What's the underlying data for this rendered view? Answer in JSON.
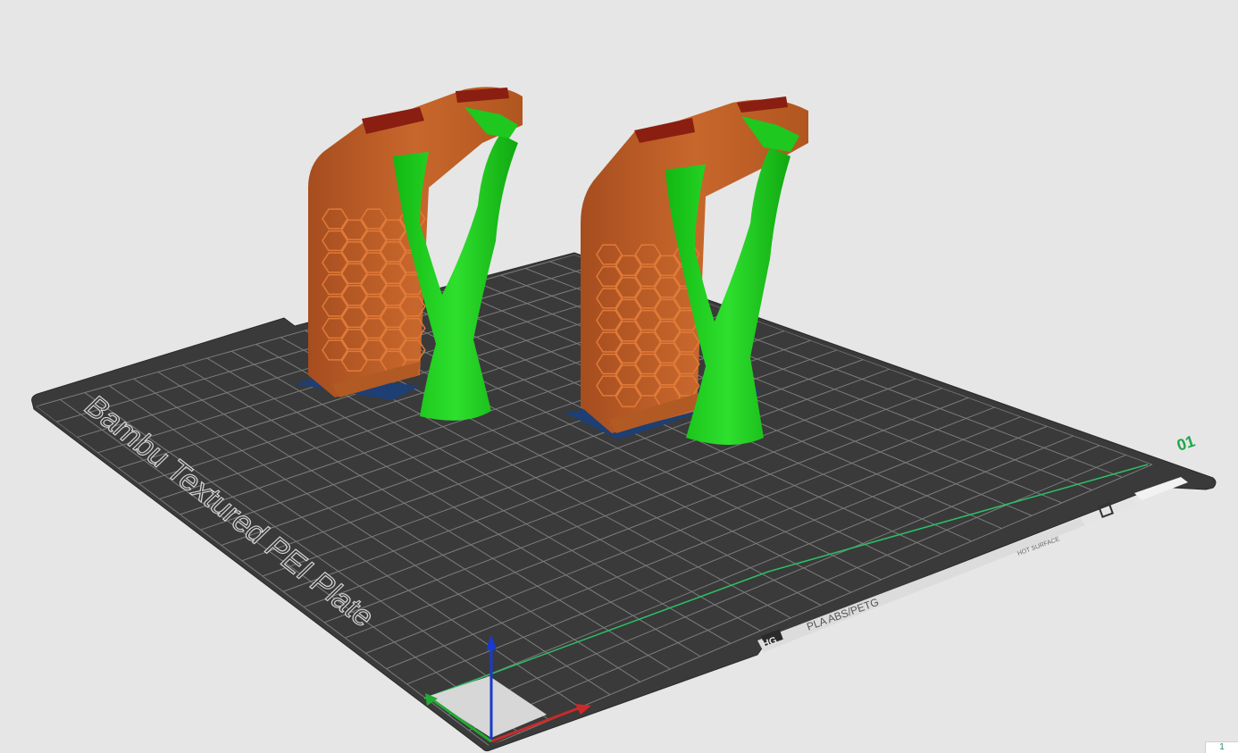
{
  "plate": {
    "name": "Bambu Textured PEI Plate",
    "number": "01",
    "materials": "PLA ABS/PETG",
    "bed_label": "HOT SURFACE"
  },
  "viewport": {
    "corner_index": "1"
  },
  "colors": {
    "background": "#e6e6e6",
    "bed": "#3c3c3c",
    "grid": "#7a7a7a",
    "model": "#c0602a",
    "support": "#15d015",
    "plate_number": "#1aa84a",
    "axis_x": "#cc2a2a",
    "axis_y": "#22aa33",
    "axis_z": "#1a3acc"
  },
  "icons": [
    "bambu-logo-icon",
    "plate-settings-icons"
  ]
}
